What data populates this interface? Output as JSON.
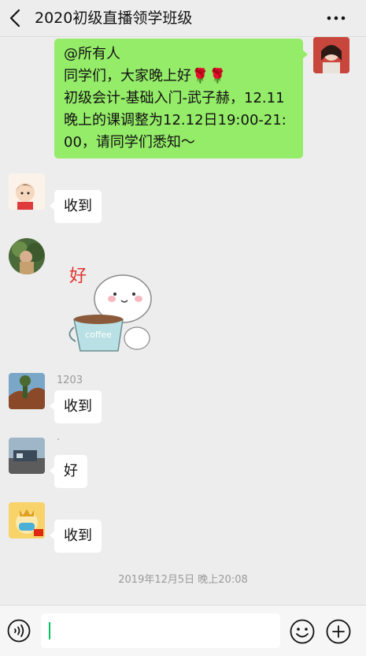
{
  "header": {
    "title": "2020初级直播领学班级",
    "back_icon": "chevron-left-icon",
    "more_icon": "more-dots-icon"
  },
  "messages": [
    {
      "side": "right",
      "lines": [
        "@所有人",
        "同学们，大家晚上好🌹🌹",
        "初级会计-基础入门-武子赫，12.11",
        "晚上的课调整为12.12日19:00-21:",
        "00，请同学们悉知～"
      ]
    },
    {
      "side": "left",
      "text": "收到"
    },
    {
      "side": "left",
      "type": "sticker",
      "sticker_text": "好",
      "cup_text": "coffee"
    },
    {
      "side": "left",
      "sender": "1203",
      "text": "收到"
    },
    {
      "side": "left",
      "sender": "·",
      "text": "好"
    },
    {
      "side": "left",
      "text": "收到"
    }
  ],
  "timestamp": "2019年12月5日 晚上20:08",
  "input_bar": {
    "voice_icon": "voice-icon",
    "emoji_icon": "emoji-icon",
    "plus_icon": "plus-icon",
    "placeholder": ""
  },
  "colors": {
    "background": "#ededed",
    "self_bubble": "#95ec69",
    "other_bubble": "#ffffff",
    "caret": "#07c160"
  }
}
